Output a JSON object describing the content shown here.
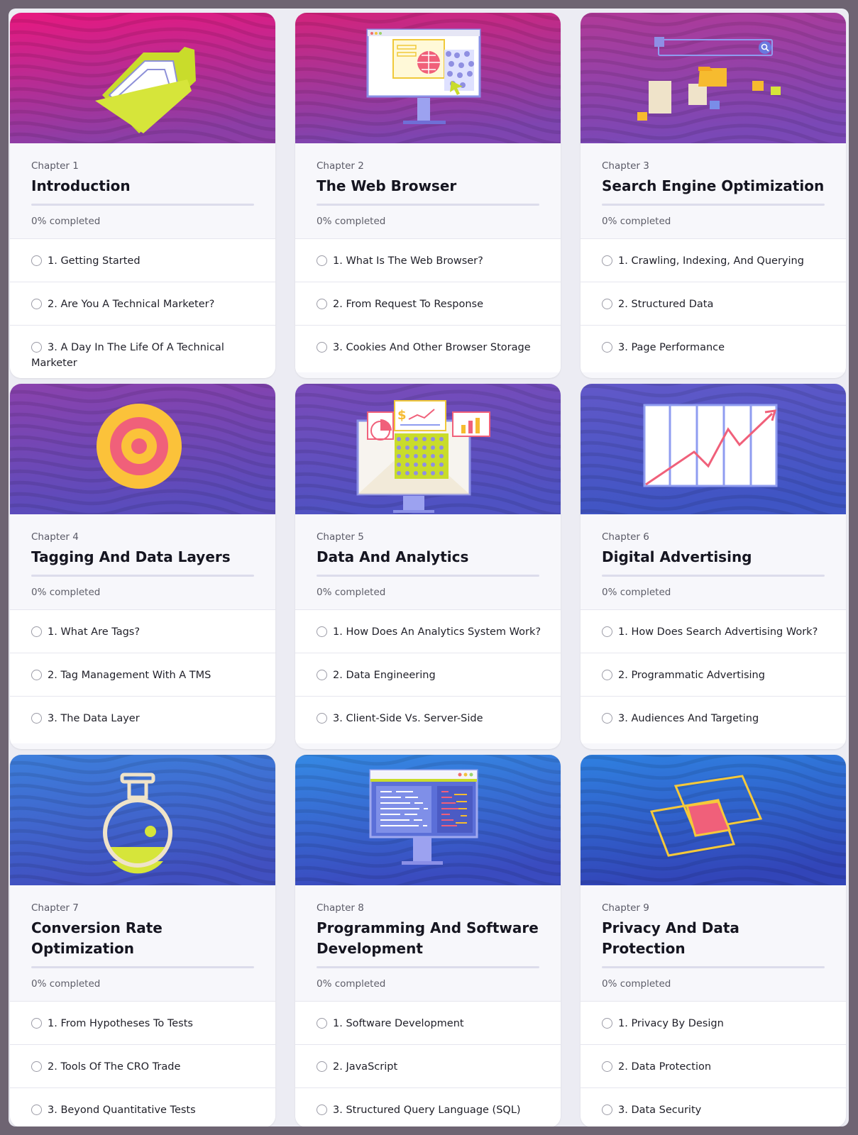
{
  "progress_suffix": "completed",
  "chapters": [
    {
      "chapter_label": "Chapter 1",
      "title": "Introduction",
      "progress": "0% completed",
      "progress_value": 0,
      "banner_colors": [
        "#e8187f",
        "#8c3ea6"
      ],
      "illustration": "folder-icon",
      "lessons": [
        "1. Getting Started",
        "2. Are You A Technical Marketer?",
        "3. A Day In The Life Of A Technical Marketer"
      ]
    },
    {
      "chapter_label": "Chapter 2",
      "title": "The Web Browser",
      "progress": "0% completed",
      "progress_value": 0,
      "banner_colors": [
        "#d4237c",
        "#7e45b0"
      ],
      "illustration": "browser-monitor-icon",
      "lessons": [
        "1. What Is The Web Browser?",
        "2. From Request To Response",
        "3. Cookies And Other Browser Storage"
      ]
    },
    {
      "chapter_label": "Chapter 3",
      "title": "Search Engine Optimization",
      "progress": "0% completed",
      "progress_value": 0,
      "banner_colors": [
        "#b03a98",
        "#7a48b6"
      ],
      "illustration": "search-results-icon",
      "lessons": [
        "1. Crawling, Indexing, And Querying",
        "2. Structured Data",
        "3. Page Performance"
      ]
    },
    {
      "chapter_label": "Chapter 4",
      "title": "Tagging And Data Layers",
      "progress": "0% completed",
      "progress_value": 0,
      "banner_colors": [
        "#8b42ad",
        "#5a4cbc"
      ],
      "illustration": "target-icon",
      "lessons": [
        "1. What Are Tags?",
        "2. Tag Management With A TMS",
        "3. The Data Layer"
      ]
    },
    {
      "chapter_label": "Chapter 5",
      "title": "Data And Analytics",
      "progress": "0% completed",
      "progress_value": 0,
      "banner_colors": [
        "#7b4bb9",
        "#4f52c2"
      ],
      "illustration": "analytics-dashboard-icon",
      "lessons": [
        "1. How Does An Analytics System Work?",
        "2. Data Engineering",
        "3. Client-Side Vs. Server-Side"
      ]
    },
    {
      "chapter_label": "Chapter 6",
      "title": "Digital Advertising",
      "progress": "0% completed",
      "progress_value": 0,
      "banner_colors": [
        "#6258c8",
        "#3f55c4"
      ],
      "illustration": "growth-chart-icon",
      "lessons": [
        "1. How Does Search Advertising Work?",
        "2. Programmatic Advertising",
        "3. Audiences And Targeting"
      ]
    },
    {
      "chapter_label": "Chapter 7",
      "title": "Conversion Rate Optimization",
      "progress": "0% completed",
      "progress_value": 0,
      "banner_colors": [
        "#3e7fdc",
        "#4150c0"
      ],
      "illustration": "flask-icon",
      "lessons": [
        "1. From Hypotheses To Tests",
        "2. Tools Of The CRO Trade",
        "3. Beyond Quantitative Tests"
      ]
    },
    {
      "chapter_label": "Chapter 8",
      "title": "Programming And Software Development",
      "progress": "0% completed",
      "progress_value": 0,
      "banner_colors": [
        "#3589e4",
        "#3a4bbf"
      ],
      "illustration": "code-editor-icon",
      "lessons": [
        "1. Software Development",
        "2. JavaScript",
        "3. Structured Query Language (SQL)"
      ]
    },
    {
      "chapter_label": "Chapter 9",
      "title": "Privacy And Data Protection",
      "progress": "0% completed",
      "progress_value": 0,
      "banner_colors": [
        "#2f80e0",
        "#3245b8"
      ],
      "illustration": "overlap-privacy-icon",
      "lessons": [
        "1. Privacy By Design",
        "2. Data Protection",
        "3. Data Security"
      ]
    }
  ]
}
